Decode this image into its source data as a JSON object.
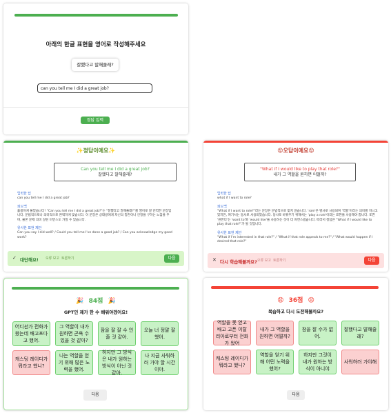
{
  "question_card": {
    "title": "아래의 한글 표현을 영어로 작성해주세요",
    "prompt_korean": "잘했다고 말해줄래?",
    "answer_input_value": "can you tell me I did a great job?",
    "submit_label": "정답 입력"
  },
  "correct_card": {
    "header": "✨정답이에요✨",
    "answer_en": "Can you tell me I did a great job?",
    "answer_ko": "잘했다고 말해줄래?",
    "my_answer_label": "입력한 답",
    "my_answer": "can you tell me I did a great job?",
    "feedback_label": "피드백",
    "feedback": "훌륭하게 풀었습니다! \"Can you tell me I did a great job?\"는 \"잘했다고 말해줄래?\"를 영어로 잘 번역한 문장입니다. 문법적으로나 의미적으로 완벽하게 맞습니다. 이 문장은 상대방에게 자신의 칭찬이나 인정을 구하는 느낌을 주며, 물론 문제 의미 살린 비언스도 가질 수 있습니다.",
    "alt_label": "유사한 표현 제안",
    "alt": "Can you say I did well? / Could you tell me I've done a good job? / Can you acknowledge my good work?",
    "status": "대단해요!",
    "status_sub1": "오류 보고",
    "status_sub2": "토론하기",
    "next_label": "다음"
  },
  "wrong_card": {
    "header": "😡오답이에요😡",
    "answer_en": "\"What if I would like to play that role?\"",
    "answer_ko": "내가 그 역할을 원하면 어떨까?",
    "my_answer_label": "입력한 답",
    "my_answer": "what if I want to role?",
    "feedback_label": "피드백",
    "feedback": "\"What if I want to role?\"라는 문장은 문법적으로 맞지 않습니다. 'role'은 명사로 사용되며 '역할'이라는 의미를 지니고 있지만, 여기서는 동사로 사용되었습니다. 동사로 바꿔주기 위해서는 'play a role'이라는 표현을 사용해야 합니다. 또한 '원한다'는 'want to'와 'would like'을 사용하는 것이 더 자연스럽습니다. 따라서 정답은 \"What if I would like to play that role?\"가 될 것입니다.",
    "alt_label": "유사한 표현 제안",
    "alt": "\"What if I'm interested in that role?\" / \"What if that role appeals to me?\" / \"What would happen if I desired that role?\"",
    "status": "다시 학습해볼까요?",
    "status_sub1": "오류 보고",
    "status_sub2": "토론하기",
    "next_label": "다음"
  },
  "result_good": {
    "score": "84점",
    "emoji": "🎉",
    "subtitle": "GPT인 제가 한 수 배워야겠어요!",
    "tiles": [
      {
        "text": "어디선가 전화가 왔는데 배고프다고 했어.",
        "correct": true
      },
      {
        "text": "그 역할이 내가 원하면 곤욕 수 있을 것 같아?",
        "correct": true
      },
      {
        "text": "잠을 잘 잘 수 인 줄 것 같아.",
        "correct": true
      },
      {
        "text": "오늘 너 정말 잘했어.",
        "correct": true
      },
      {
        "text": "캐스팅 레이디가 뭐라고 했니?",
        "correct": false
      },
      {
        "text": "나는 역할을 얻기 위해 많은 노력을 했어.",
        "correct": true
      },
      {
        "text": "하지만 그 방식은 내가 원하는 방식이 아닌 것 같아.",
        "correct": true
      },
      {
        "text": "나 지금 사워하러 가야 할 시간이야.",
        "correct": true
      }
    ],
    "next_label": "다음"
  },
  "result_bad": {
    "score": "36점",
    "emoji": "😧",
    "subtitle": "복습하고 다시 도전해볼까요?",
    "tiles": [
      {
        "text": "역할을 못 얻고 배고 고픈 이탈리아로부터 전화가 왔어",
        "correct": false
      },
      {
        "text": "내가 그 역할을 원하면 어떨까?",
        "correct": false
      },
      {
        "text": "잠을 잘 수가 없어.",
        "correct": true
      },
      {
        "text": "잘했다고 말해줄래?",
        "correct": true
      },
      {
        "text": "캐스팅 레이디가 뭐라고 했니?",
        "correct": false
      },
      {
        "text": "역할을 얻기 위해 어떤 노력을 했어?",
        "correct": true
      },
      {
        "text": "하지만 그것이 내가 원하는 방식이 아니야",
        "correct": true
      },
      {
        "text": "사워하러 가야해",
        "correct": false
      }
    ],
    "next_label": "다음"
  },
  "colors": {
    "green": "#4caf50",
    "green_light": "#c8f2c6",
    "red": "#f44336",
    "red_light": "#fbd0d0",
    "blue": "#3b6fd8"
  }
}
